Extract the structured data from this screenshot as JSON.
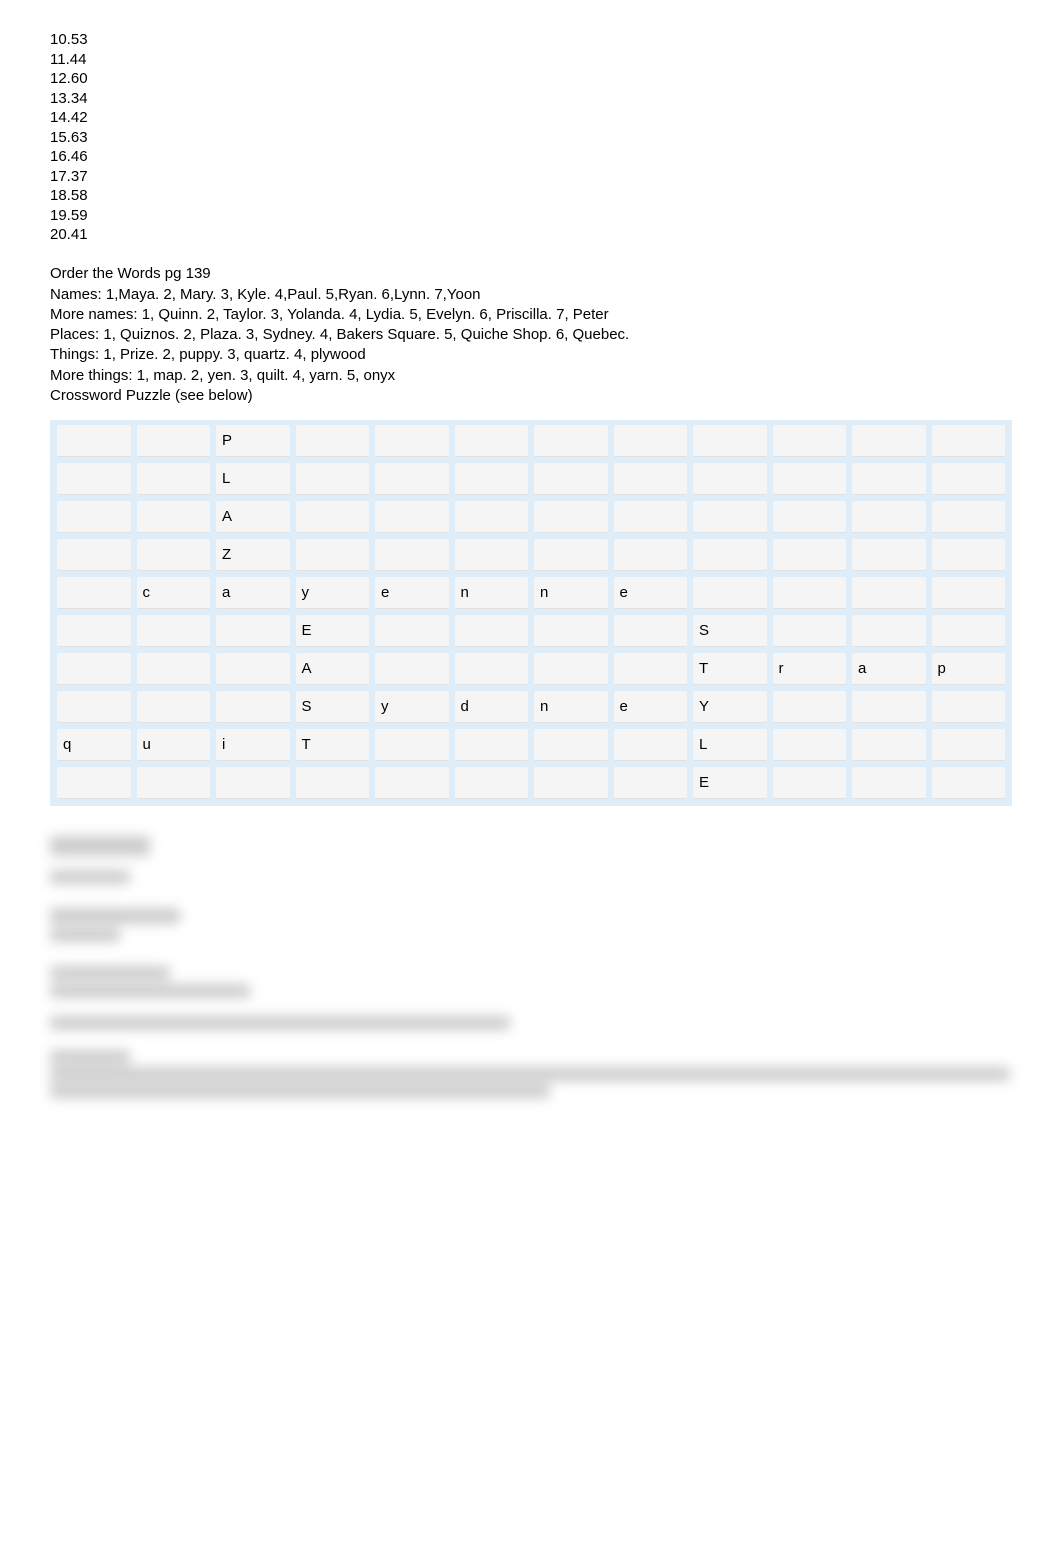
{
  "numbers": [
    "10.53",
    "11.44",
    "12.60",
    "13.34",
    "14.42",
    "15.63",
    "16.46",
    "17.37",
    "18.58",
    "19.59",
    "20.41"
  ],
  "section_title": "Order the Words pg 139",
  "lines": [
    "Names: 1,Maya. 2, Mary. 3, Kyle. 4,Paul. 5,Ryan. 6,Lynn. 7,Yoon",
    "More names: 1, Quinn. 2, Taylor. 3, Yolanda. 4, Lydia. 5, Evelyn. 6, Priscilla. 7, Peter",
    "Places: 1, Quiznos. 2, Plaza. 3, Sydney. 4, Bakers Square. 5, Quiche Shop. 6, Quebec.",
    "Things: 1, Prize. 2, puppy. 3, quartz. 4, plywood",
    "More things: 1, map. 2, yen. 3, quilt. 4, yarn. 5, onyx",
    "Crossword Puzzle (see below)"
  ],
  "crossword": [
    [
      "",
      "",
      "P",
      "",
      "",
      "",
      "",
      "",
      "",
      "",
      "",
      ""
    ],
    [
      "",
      "",
      "L",
      "",
      "",
      "",
      "",
      "",
      "",
      "",
      "",
      ""
    ],
    [
      "",
      "",
      "A",
      "",
      "",
      "",
      "",
      "",
      "",
      "",
      "",
      ""
    ],
    [
      "",
      "",
      "Z",
      "",
      "",
      "",
      "",
      "",
      "",
      "",
      "",
      ""
    ],
    [
      "",
      "c",
      "a",
      "y",
      "e",
      "n",
      "n",
      "e",
      "",
      "",
      "",
      ""
    ],
    [
      "",
      "",
      "",
      "E",
      "",
      "",
      "",
      "",
      "S",
      "",
      "",
      ""
    ],
    [
      "",
      "",
      "",
      "A",
      "",
      "",
      "",
      "",
      "T",
      "r",
      "a",
      "p"
    ],
    [
      "",
      "",
      "",
      "S",
      "y",
      "d",
      "n",
      "e",
      "Y",
      "",
      "",
      ""
    ],
    [
      "q",
      "u",
      "i",
      "T",
      "",
      "",
      "",
      "",
      "L",
      "",
      "",
      ""
    ],
    [
      "",
      "",
      "",
      "",
      "",
      "",
      "",
      "",
      "E",
      "",
      "",
      ""
    ]
  ]
}
